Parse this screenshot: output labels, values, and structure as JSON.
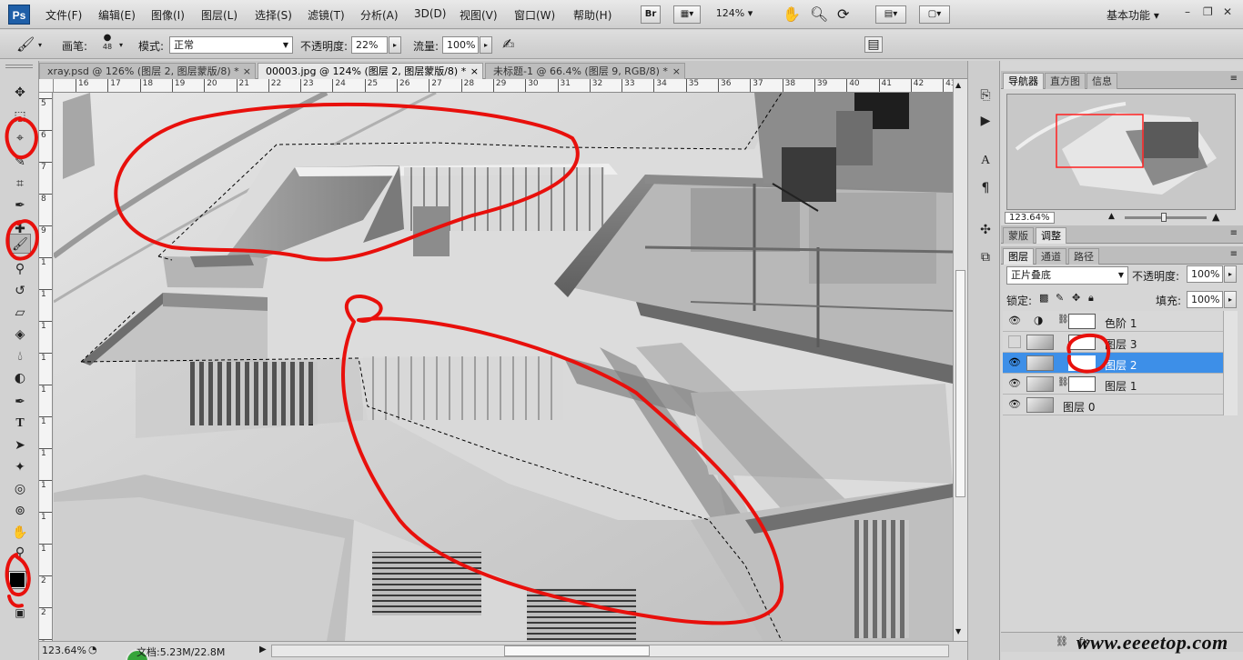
{
  "app": {
    "logo": "Ps"
  },
  "menu": [
    "文件(F)",
    "编辑(E)",
    "图像(I)",
    "图层(L)",
    "选择(S)",
    "滤镜(T)",
    "分析(A)",
    "3D(D)",
    "视图(V)",
    "窗口(W)",
    "帮助(H)"
  ],
  "appbar": {
    "bridge": "Br",
    "zoom": "124%",
    "workspace": "基本功能"
  },
  "options": {
    "brush_label": "画笔:",
    "brush_size": "48",
    "mode_label": "模式:",
    "mode_value": "正常",
    "opacity_label": "不透明度:",
    "opacity_value": "22%",
    "flow_label": "流量:",
    "flow_value": "100%"
  },
  "tabs": [
    {
      "label": "xray.psd @ 126% (图层 2, 图层蒙版/8) *"
    },
    {
      "label": "00003.jpg @ 124% (图层 2, 图层蒙版/8) *"
    },
    {
      "label": "未标题-1 @ 66.4% (图层 9, RGB/8) *"
    }
  ],
  "ruler_top": [
    "16",
    "17",
    "18",
    "19",
    "20",
    "21",
    "22",
    "23",
    "24",
    "25",
    "26",
    "27",
    "28",
    "29",
    "30",
    "31",
    "32",
    "33",
    "34",
    "35",
    "36",
    "37",
    "38",
    "39",
    "40",
    "41",
    "42",
    "43"
  ],
  "ruler_left": [
    "5",
    "6",
    "7",
    "8",
    "9",
    "1",
    "1",
    "1",
    "1",
    "1",
    "1",
    "1",
    "1",
    "1",
    "1",
    "2",
    "2",
    "2"
  ],
  "status": {
    "zoom": "123.64%",
    "doc": "文档:5.23M/22.8M"
  },
  "navigator": {
    "tabs": [
      "导航器",
      "直方图",
      "信息"
    ],
    "zoom": "123.64%"
  },
  "adjust_tabs": [
    "蒙版",
    "调整"
  ],
  "layers_panel": {
    "tabs": [
      "图层",
      "通道",
      "路径"
    ],
    "blend_mode": "正片叠底",
    "opacity_label": "不透明度:",
    "opacity_value": "100%",
    "lock_label": "锁定:",
    "fill_label": "填充:",
    "fill_value": "100%",
    "layers": [
      {
        "name": "色阶 1",
        "visible": true
      },
      {
        "name": "图层 3",
        "visible": false
      },
      {
        "name": "图层 2",
        "visible": true,
        "selected": true
      },
      {
        "name": "图层 1",
        "visible": true
      },
      {
        "name": "图层 0",
        "visible": true
      }
    ]
  },
  "watermark": "www.eeeetop.com",
  "colors": {
    "annotation": "#e8100c",
    "selected_layer": "#3d8fe8"
  }
}
